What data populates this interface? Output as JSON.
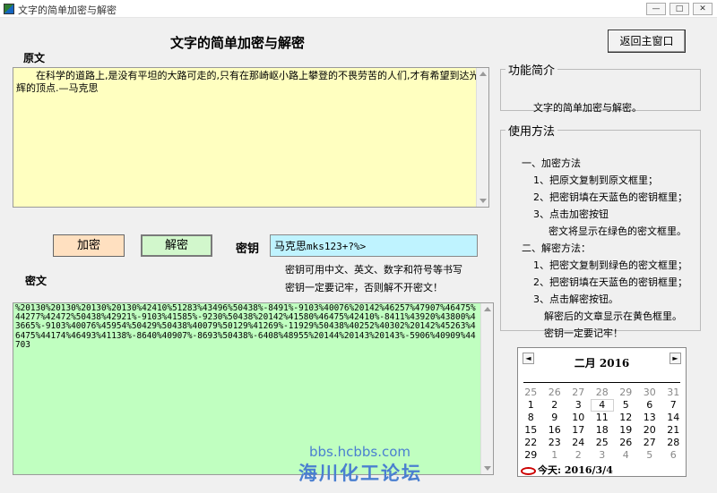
{
  "window": {
    "title": "文字的简单加密与解密",
    "controls": [
      "—",
      "□",
      "✕"
    ]
  },
  "header": {
    "title": "文字的简单加密与解密",
    "back_button": "返回主窗口"
  },
  "original": {
    "label": "原文",
    "text": "　　在科学的道路上,是没有平坦的大路可走的,只有在那崎岖小路上攀登的不畏劳苦的人们,才有希望到达光辉的顶点.—马克思"
  },
  "actions": {
    "encrypt": "加密",
    "decrypt": "解密"
  },
  "key": {
    "label": "密钥",
    "value_cjk": "马克思",
    "value_ascii": "mks123+?%>",
    "hint1": "密钥可用中文、英文、数字和符号等书写",
    "hint2": "密钥一定要记牢，否则解不开密文！"
  },
  "cipher": {
    "label": "密文",
    "text": "%20130%20130%20130%20130%42410%51283%43496%50438%-8491%-9103%40076%20142%46257%47907%46475%44277%42472%50438%42921%-9103%41585%-9230%50438%20142%41580%46475%42410%-8411%43920%43800%43665%-9103%40076%45954%50429%50438%40079%50129%41269%-11929%50438%40252%40302%20142%45263%46475%44174%46493%41138%-8640%40907%-8693%50438%-6408%48955%20144%20143%20143%-5906%40909%44703"
  },
  "intro": {
    "title": "功能简介",
    "text": "文字的简单加密与解密。"
  },
  "usage": {
    "title": "使用方法",
    "lines": [
      "一、加密方法",
      "1、把原文复制到原文框里；",
      "2、把密钥填在天蓝色的密钥框里；",
      "3、点击加密按钮",
      "密文将显示在绿色的密文框里。",
      "二、解密方法：",
      "1、把密文复制到绿色的密文框里；",
      "2、把密钥填在天蓝色的密钥框里；",
      "3、点击解密按钮。",
      "解密后的文章显示在黄色框里。",
      "密钥一定要记牢！"
    ]
  },
  "calendar": {
    "month_label": "二月  2016",
    "prev": "◄",
    "next": "►",
    "days": [
      {
        "d": "25",
        "o": true
      },
      {
        "d": "26",
        "o": true
      },
      {
        "d": "27",
        "o": true
      },
      {
        "d": "28",
        "o": true
      },
      {
        "d": "29",
        "o": true
      },
      {
        "d": "30",
        "o": true
      },
      {
        "d": "31",
        "o": true
      },
      {
        "d": "1"
      },
      {
        "d": "2"
      },
      {
        "d": "3"
      },
      {
        "d": "4",
        "today": true
      },
      {
        "d": "5"
      },
      {
        "d": "6"
      },
      {
        "d": "7"
      },
      {
        "d": "8"
      },
      {
        "d": "9"
      },
      {
        "d": "10"
      },
      {
        "d": "11"
      },
      {
        "d": "12"
      },
      {
        "d": "13"
      },
      {
        "d": "14"
      },
      {
        "d": "15"
      },
      {
        "d": "16"
      },
      {
        "d": "17"
      },
      {
        "d": "18"
      },
      {
        "d": "19"
      },
      {
        "d": "20"
      },
      {
        "d": "21"
      },
      {
        "d": "22"
      },
      {
        "d": "23"
      },
      {
        "d": "24"
      },
      {
        "d": "25"
      },
      {
        "d": "26"
      },
      {
        "d": "27"
      },
      {
        "d": "28"
      },
      {
        "d": "29"
      },
      {
        "d": "1",
        "o": true
      },
      {
        "d": "2",
        "o": true
      },
      {
        "d": "3",
        "o": true
      },
      {
        "d": "4",
        "o": true
      },
      {
        "d": "5",
        "o": true
      },
      {
        "d": "6",
        "o": true
      }
    ],
    "today_label": "今天: 2016/3/4"
  },
  "watermark": {
    "url": "bbs.hcbbs.com",
    "name": "海川化工论坛"
  },
  "colors": {
    "original_bg": "#ffffc0",
    "cipher_bg": "#c0ffc0",
    "key_bg": "#bff3ff",
    "encrypt_bg": "#ffe0c0",
    "decrypt_bg": "#d2f7cc",
    "watermark": "#4a7fd0"
  }
}
